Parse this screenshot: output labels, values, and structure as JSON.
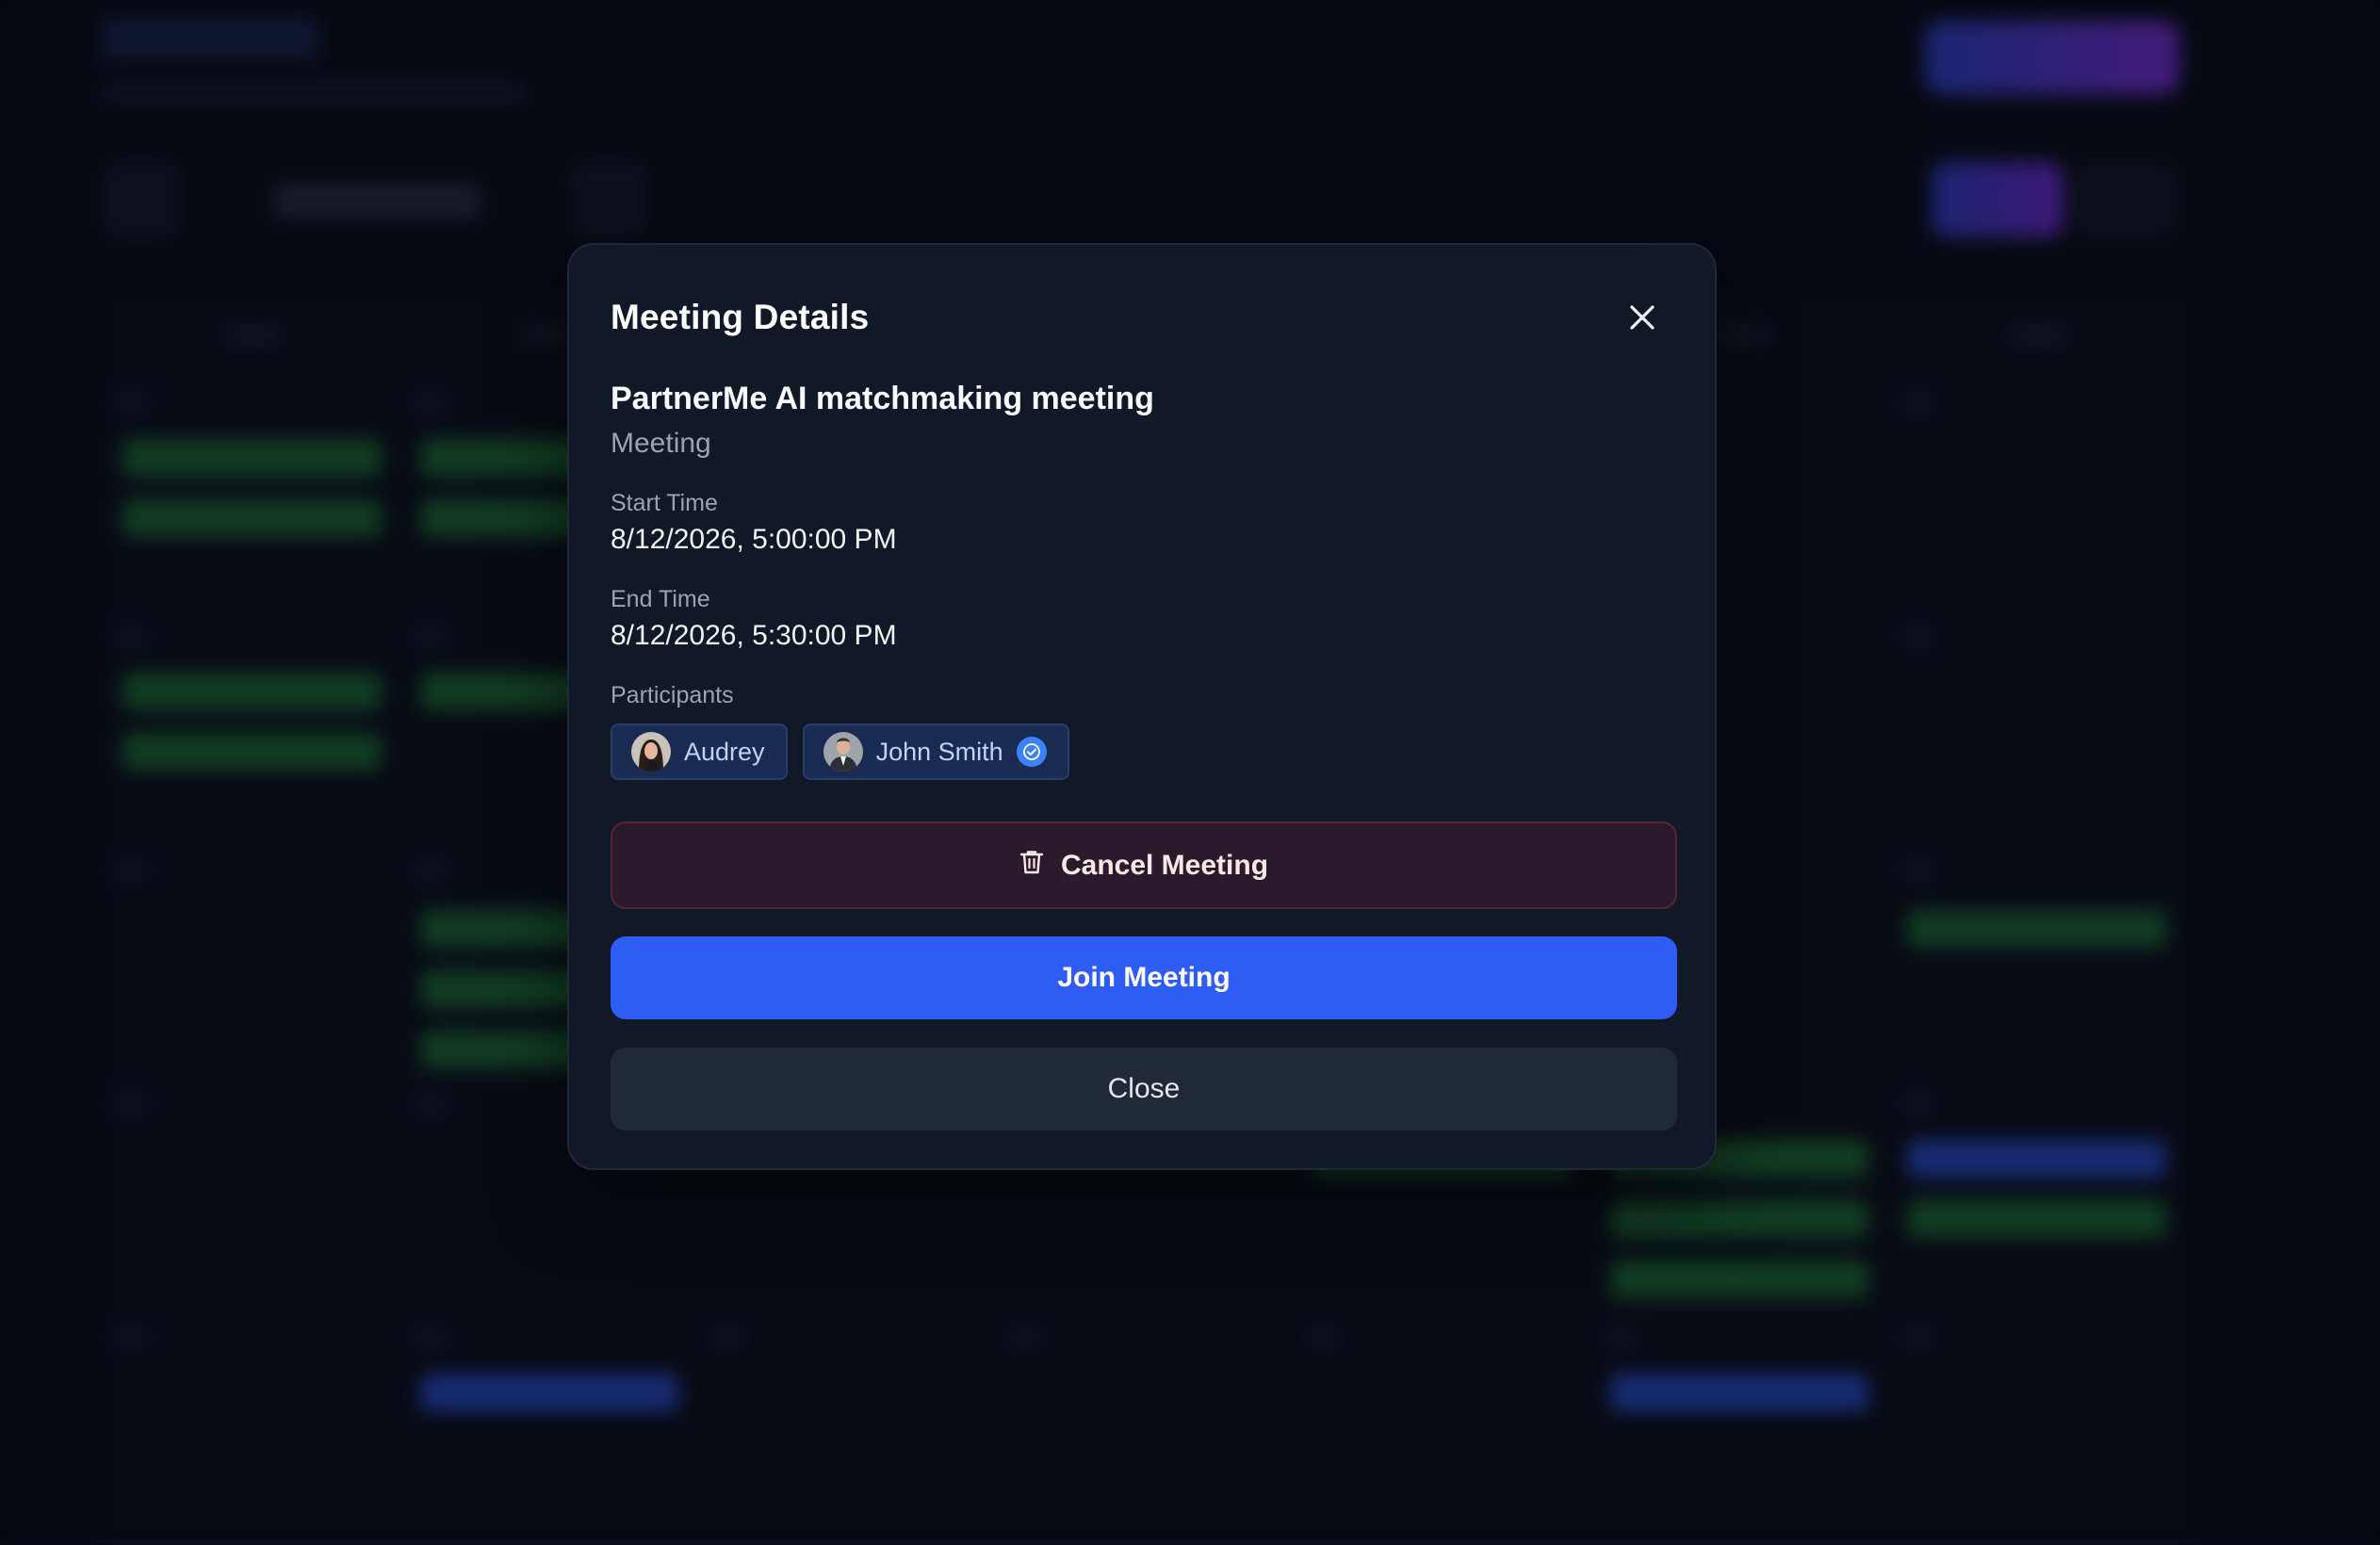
{
  "modal": {
    "title": "Meeting Details",
    "close_icon": "close-icon",
    "meeting_name": "PartnerMe AI matchmaking meeting",
    "meeting_type": "Meeting",
    "start_time_label": "Start Time",
    "start_time_value": "8/12/2026, 5:00:00 PM",
    "end_time_label": "End Time",
    "end_time_value": "8/12/2026, 5:30:00 PM",
    "participants_label": "Participants",
    "participants": [
      {
        "name": "Audrey",
        "verified": false
      },
      {
        "name": "John Smith",
        "verified": true
      }
    ],
    "cancel_label": "Cancel Meeting",
    "cancel_icon": "trash-icon",
    "join_label": "Join Meeting",
    "close_label": "Close"
  },
  "colors": {
    "modal_bg": "#111827",
    "primary": "#2f5cf5",
    "danger_bg": "#2a1a2c",
    "chip_bg": "#1a2b52",
    "verified": "#3b82f6"
  }
}
